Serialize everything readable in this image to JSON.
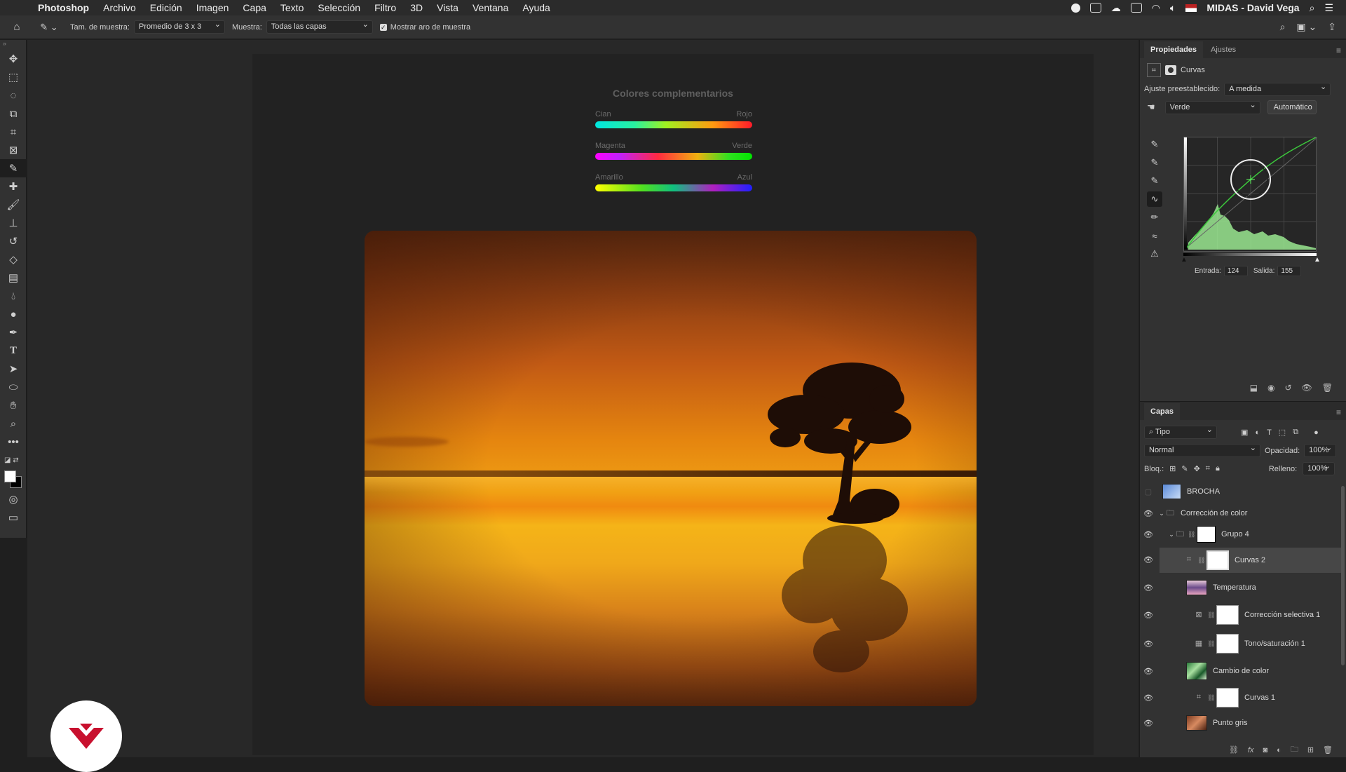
{
  "menubar": {
    "app_name": "Photoshop",
    "items": [
      "Archivo",
      "Edición",
      "Imagen",
      "Capa",
      "Texto",
      "Selección",
      "Filtro",
      "3D",
      "Vista",
      "Ventana",
      "Ayuda"
    ],
    "user": "MIDAS - David Vega"
  },
  "options_bar": {
    "sample_size_label": "Tam. de muestra:",
    "sample_size_value": "Promedio de 3 x 3",
    "sample_label": "Muestra:",
    "sample_value": "Todas las capas",
    "show_ring_label": "Mostrar aro de muestra",
    "show_ring_checked": true
  },
  "canvas": {
    "title": "Colores complementarios",
    "gradients": [
      {
        "left": "Cian",
        "right": "Rojo",
        "from": "#00e5e5",
        "to": "#ff1a1a"
      },
      {
        "left": "Magenta",
        "right": "Verde",
        "from": "#ff00ff",
        "to": "#00e600"
      },
      {
        "left": "Amarillo",
        "right": "Azul",
        "from": "#ffff00",
        "to": "#1a1aff"
      }
    ]
  },
  "properties": {
    "tab_active": "Propiedades",
    "tab_other": "Ajustes",
    "adjustment_name": "Curvas",
    "preset_label": "Ajuste preestablecido:",
    "preset_value": "A medida",
    "channel_value": "Verde",
    "auto_button": "Automático",
    "input_label": "Entrada:",
    "input_value": "124",
    "output_label": "Salida:",
    "output_value": "155"
  },
  "layers_panel": {
    "title": "Capas",
    "filter_value": "Tipo",
    "blend_mode": "Normal",
    "opacity_label": "Opacidad:",
    "opacity_value": "100%",
    "lock_label": "Bloq.:",
    "fill_label": "Relleno:",
    "fill_value": "100%",
    "layers": [
      {
        "name": "BROCHA",
        "visible": false,
        "kind": "image"
      },
      {
        "name": "Corrección de color",
        "visible": true,
        "kind": "group"
      },
      {
        "name": "Grupo 4",
        "visible": true,
        "kind": "group"
      },
      {
        "name": "Curvas 2",
        "visible": true,
        "kind": "curves",
        "selected": true
      },
      {
        "name": "Temperatura",
        "visible": true,
        "kind": "image"
      },
      {
        "name": "Corrección selectiva 1",
        "visible": true,
        "kind": "selective"
      },
      {
        "name": "Tono/saturación 1",
        "visible": true,
        "kind": "huesat"
      },
      {
        "name": "Cambio de color",
        "visible": true,
        "kind": "image"
      },
      {
        "name": "Curvas 1",
        "visible": true,
        "kind": "curves"
      },
      {
        "name": "Punto gris",
        "visible": true,
        "kind": "image"
      }
    ]
  },
  "colors": {
    "accent_curve": "#3cc83c",
    "brand_logo": "#c8102e"
  }
}
